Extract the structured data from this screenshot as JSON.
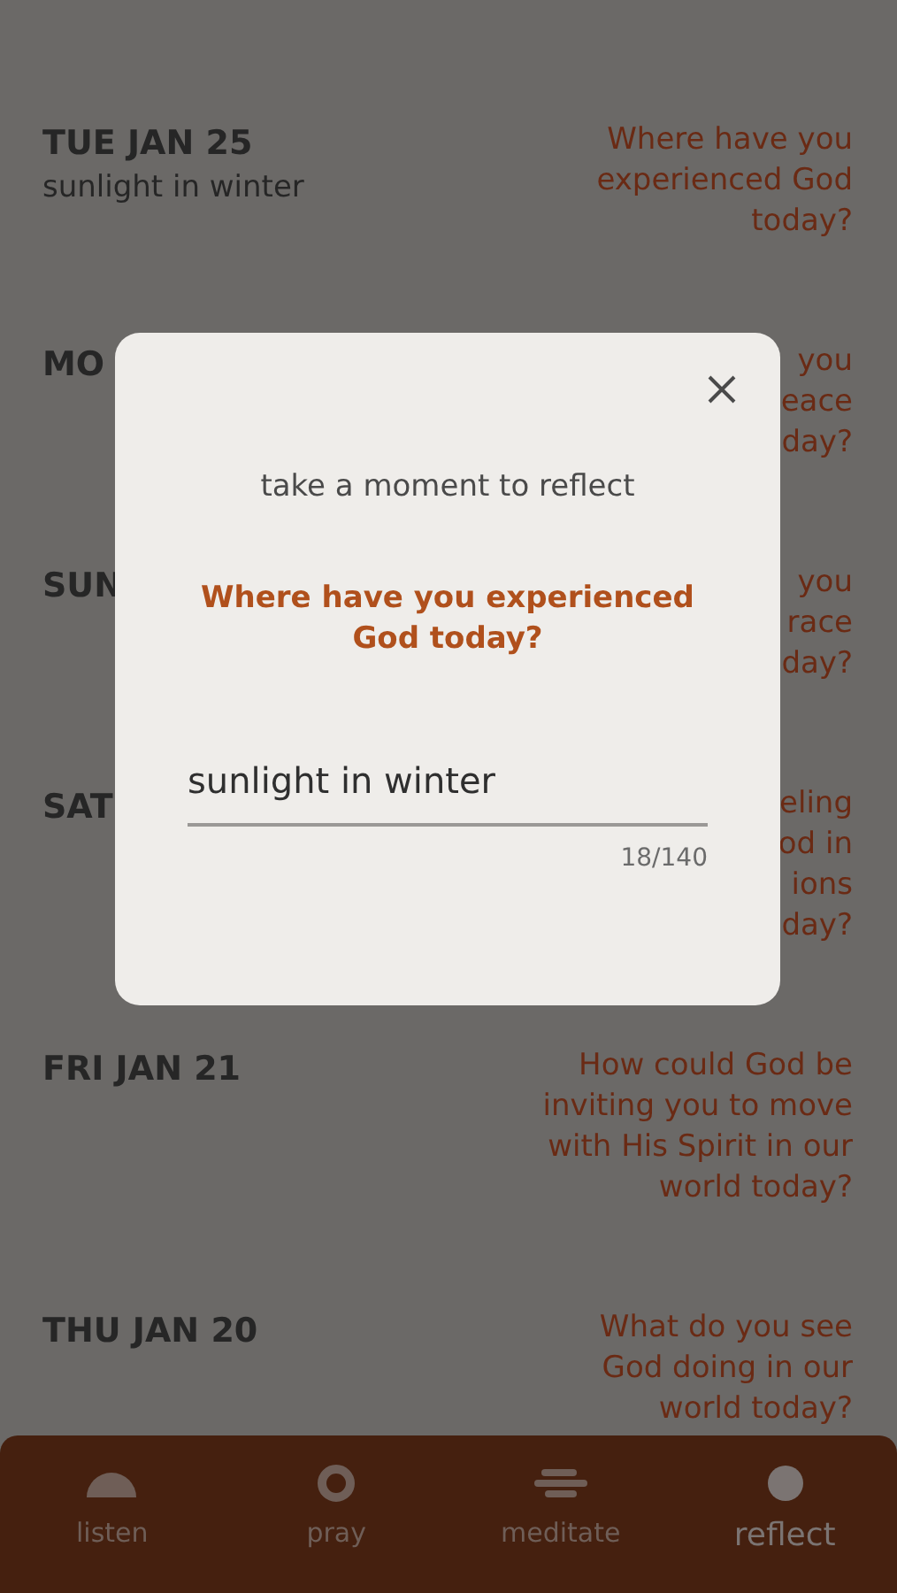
{
  "entries": [
    {
      "date": "TUE JAN 25",
      "note": "sunlight in winter",
      "question_lines": [
        "Where have you",
        "experienced God",
        "today?"
      ]
    },
    {
      "date": "MO",
      "question_lines": [
        "you",
        "eace",
        "day?"
      ]
    },
    {
      "date": "SUN",
      "question_lines": [
        "you",
        "race",
        "day?"
      ]
    },
    {
      "date": "SAT",
      "question_lines": [
        "eling",
        "od in",
        "ions",
        "day?"
      ]
    },
    {
      "date": "FRI JAN 21",
      "question_lines": [
        "How could God be",
        "inviting you to move",
        "with His Spirit in our",
        "world today?"
      ]
    },
    {
      "date": "THU JAN 20",
      "question_lines": [
        "What do you see",
        "God doing in our",
        "world today?"
      ]
    }
  ],
  "dialog": {
    "subtitle": "take a moment to reflect",
    "question": "Where have you experienced God today?",
    "answer": {
      "value": "sunlight in winter",
      "counter": "18/140"
    }
  },
  "tabs": [
    {
      "label": "listen",
      "kind": "dome",
      "selected": false
    },
    {
      "label": "pray",
      "kind": "ring",
      "selected": false
    },
    {
      "label": "meditate",
      "kind": "bars",
      "selected": false
    },
    {
      "label": "reflect",
      "kind": "dot",
      "selected": true
    }
  ]
}
